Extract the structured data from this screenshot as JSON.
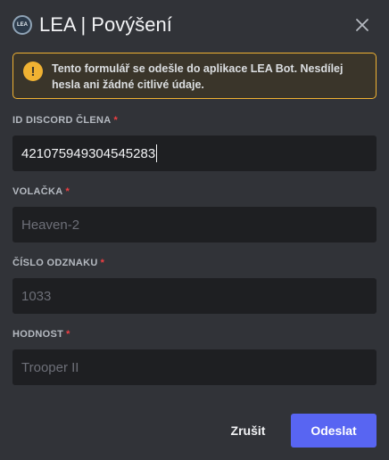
{
  "header": {
    "icon_text": "LEA",
    "title": "LEA | Povýšení",
    "close_icon": "close-icon"
  },
  "warning": {
    "icon": "exclamation-icon",
    "text": "Tento formulář se odešle do aplikace LEA Bot. Nesdílej hesla ani žádné citlivé údaje."
  },
  "fields": [
    {
      "label": "ID DISCORD ČLENA",
      "required": "*",
      "value": "421075949304545283",
      "placeholder": ""
    },
    {
      "label": "VOLAČKA",
      "required": "*",
      "value": "",
      "placeholder": "Heaven-2"
    },
    {
      "label": "ČÍSLO ODZNAKU",
      "required": "*",
      "value": "",
      "placeholder": "1033"
    },
    {
      "label": "HODNOST",
      "required": "*",
      "value": "",
      "placeholder": "Trooper II"
    }
  ],
  "footer": {
    "cancel_label": "Zrušit",
    "submit_label": "Odeslat"
  },
  "colors": {
    "background": "#313338",
    "input_bg": "#1e1f22",
    "warning_border": "#f0b232",
    "required": "#f23f43",
    "primary_button": "#5865f2"
  }
}
